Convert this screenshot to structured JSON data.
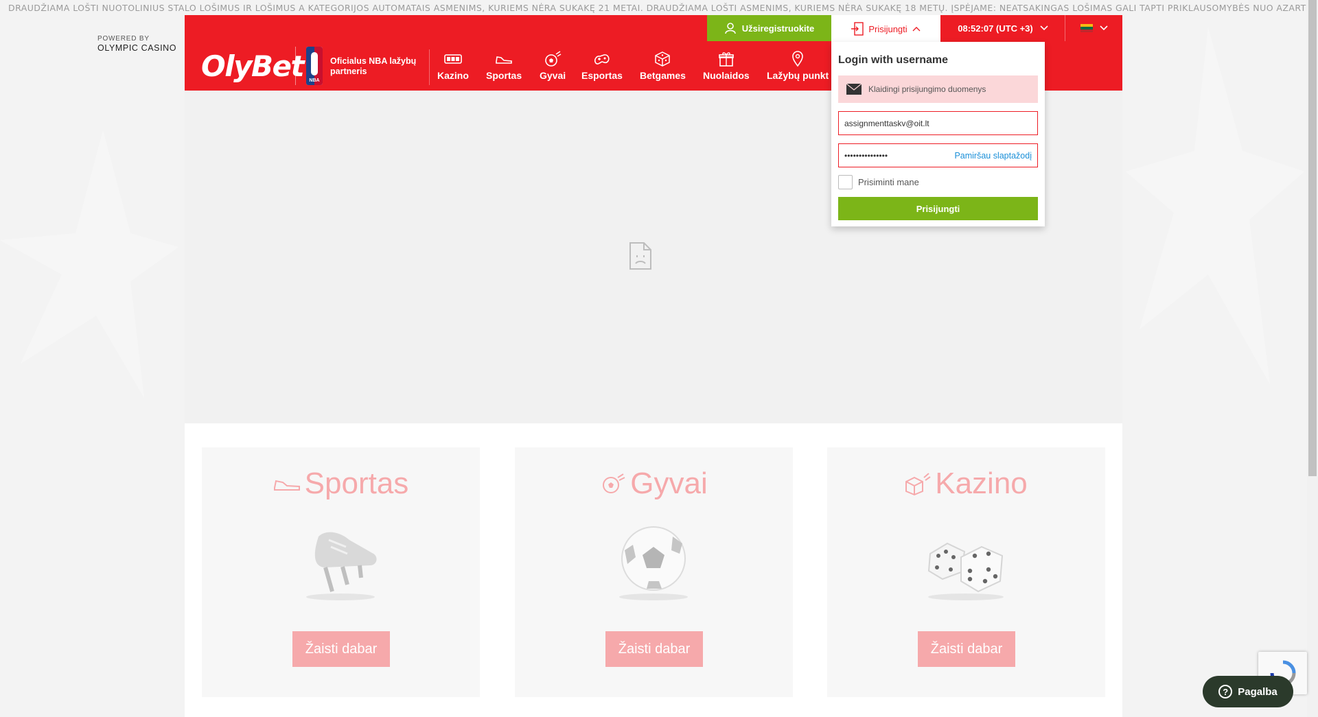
{
  "ticker": {
    "text": "DRAUDŽIAMA LOŠTI NUOTOLINIUS STALO LOŠIMUS IR LOŠIMUS A KATEGORIJOS AUTOMATAIS ASMENIMS, KURIEMS NĖRA SUKAKĘ 21 METAI. DRAUDŽIAMA LOŠTI ASMENIMS, KURIEMS NĖRA SUKAKĘ 18 METŲ. ĮSPĖJAME: NEATSAKINGAS LOŠIMAS GALI TAPTI PRIKLAUSOMYBĖS NUO AZARTINIŲ LOŠIMŲ PRIEŽASTIMI"
  },
  "powered": {
    "line1": "POWERED BY",
    "line2": "OLYMPIC CASINO"
  },
  "header": {
    "register_label": "Užsiregistruokite",
    "login_label": "Prisijungti",
    "clock": "08:52:07 (UTC +3)",
    "logo": "OlyBet",
    "nba_partner": "Oficialus NBA lažybų partneris",
    "nba_badge": "NBA",
    "flag_colors": [
      "#fdb913",
      "#006a44",
      "#c1272d"
    ]
  },
  "nav": {
    "items": [
      {
        "label": "Kazino",
        "icon": "slot-machine-icon"
      },
      {
        "label": "Sportas",
        "icon": "sneaker-icon"
      },
      {
        "label": "Gyvai",
        "icon": "soccer-ball-icon"
      },
      {
        "label": "Esportas",
        "icon": "gamepad-icon"
      },
      {
        "label": "Betgames",
        "icon": "dice-icon"
      },
      {
        "label": "Nuolaidos",
        "icon": "gift-icon"
      },
      {
        "label": "Lažybų punkt",
        "icon": "location-pin-icon"
      }
    ]
  },
  "login": {
    "title": "Login with username",
    "error": "Klaidingi prisijungimo duomenys",
    "username_value": "assignmenttaskv@oit.lt",
    "password_value": "•••••••••••••••",
    "forgot": "Pamiršau slaptažodį",
    "remember": "Prisiminti mane",
    "submit": "Prisijungti"
  },
  "cards": [
    {
      "title": "Sportas",
      "button": "Žaisti dabar"
    },
    {
      "title": "Gyvai",
      "button": "Žaisti dabar"
    },
    {
      "title": "Kazino",
      "button": "Žaisti dabar"
    }
  ],
  "help": {
    "label": "Pagalba"
  },
  "colors": {
    "brand_red": "#ed1c24",
    "green": "#7cb518",
    "pink": "#f6a9ab",
    "link_blue": "#1a8fd8"
  }
}
